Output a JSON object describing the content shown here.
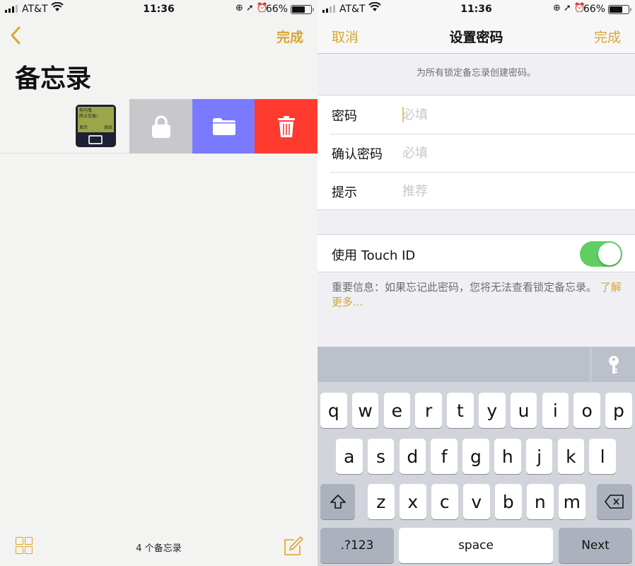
{
  "status_bar": {
    "carrier": "AT&T",
    "time": "11:36",
    "battery_percent": "66%",
    "battery_level": 0.66,
    "icons": [
      "signal-icon",
      "wifi-icon",
      "rotation-lock-icon",
      "location-icon",
      "alarm-icon",
      "battery-icon"
    ]
  },
  "left": {
    "back_icon": "chevron-left-icon",
    "done_label": "完成",
    "title": "备忘录",
    "note_thumbnail_text": [
      "有内鬼",
      "终止交易!",
      "显示",
      "退出"
    ],
    "swipe_actions": [
      {
        "name": "lock",
        "icon": "lock-icon",
        "color": "#c7c7cc"
      },
      {
        "name": "move",
        "icon": "folder-icon",
        "color": "#7a7aff"
      },
      {
        "name": "delete",
        "icon": "trash-icon",
        "color": "#ff3b30"
      }
    ],
    "note_count": "4 个备忘录",
    "toolbar_icons": [
      "grid-view-icon",
      "compose-icon"
    ]
  },
  "right": {
    "nav": {
      "cancel_label": "取消",
      "title": "设置密码",
      "done_label": "完成"
    },
    "hint": "为所有锁定备忘录创建密码。",
    "fields": [
      {
        "label": "密码",
        "value": "",
        "placeholder": "必填"
      },
      {
        "label": "确认密码",
        "value": "",
        "placeholder": "必填"
      },
      {
        "label": "提示",
        "value": "",
        "placeholder": "推荐"
      }
    ],
    "touch_id": {
      "label": "使用 Touch ID",
      "enabled": true
    },
    "warning": "重要信息：如果忘记此密码，您将无法查看锁定备忘录。",
    "learn_more": "了解更多..."
  },
  "keyboard": {
    "row1": [
      "q",
      "w",
      "e",
      "r",
      "t",
      "y",
      "u",
      "i",
      "o",
      "p"
    ],
    "row2": [
      "a",
      "s",
      "d",
      "f",
      "g",
      "h",
      "j",
      "k",
      "l"
    ],
    "row3": [
      "z",
      "x",
      "c",
      "v",
      "b",
      "n",
      "m"
    ],
    "shift_icon": "shift-icon",
    "delete_icon": "backspace-icon",
    "numbers_label": ".?123",
    "space_label": "space",
    "return_label": "Next",
    "password_icon": "key-icon"
  },
  "colors": {
    "accent": "#d9a62e",
    "toggle_on": "#5fcf63"
  }
}
